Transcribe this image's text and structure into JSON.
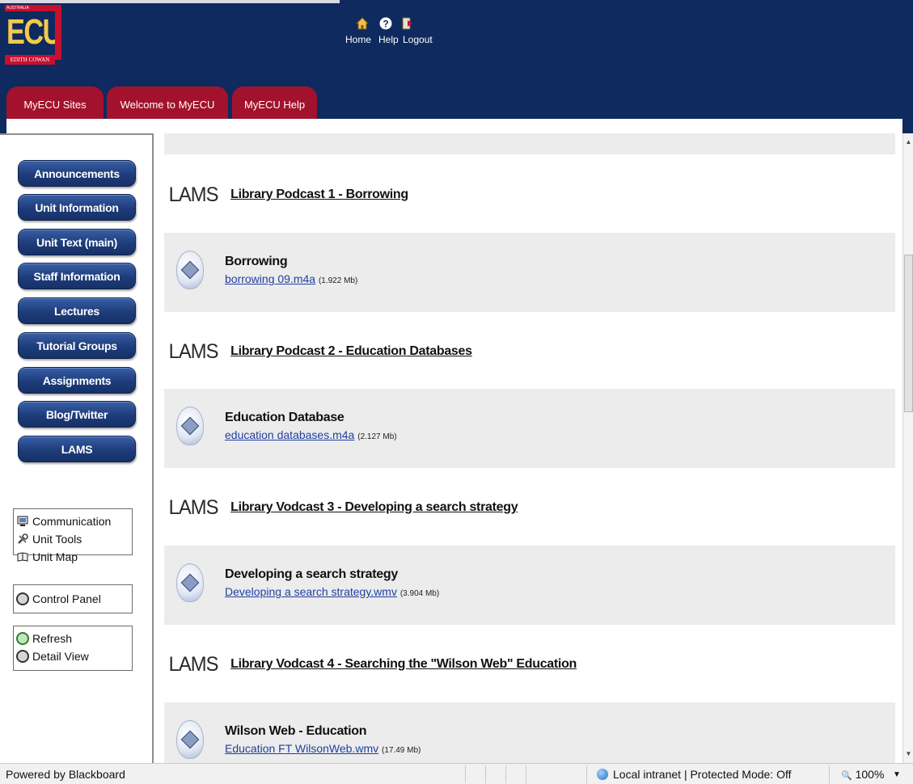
{
  "header": {
    "logo": {
      "top_text": "AUSTRALIA",
      "main_text": "ECU",
      "side_text": "UNIVERSITY",
      "bottom_text": "EDITH COWAN"
    },
    "nav": {
      "home_label": "Home",
      "help_label": "Help",
      "logout_label": "Logout",
      "icons": [
        "home-icon",
        "help-icon",
        "logout-icon"
      ]
    },
    "tabs": [
      {
        "label": "MyECU Sites"
      },
      {
        "label": "Welcome to MyECU"
      },
      {
        "label": "MyECU Help"
      }
    ]
  },
  "sidebar": {
    "buttons": [
      {
        "label": "Announcements"
      },
      {
        "label": "Unit Information"
      },
      {
        "label": "Unit Text (main)"
      },
      {
        "label": "Staff Information"
      },
      {
        "label": "Lectures"
      },
      {
        "label": "Tutorial Groups"
      },
      {
        "label": "Assignments"
      },
      {
        "label": "Blog/Twitter"
      },
      {
        "label": "LAMS"
      }
    ],
    "tools": {
      "communication": "Communication",
      "unit_tools": "Unit Tools",
      "unit_map": "Unit Map",
      "control_panel": "Control Panel",
      "refresh": "Refresh",
      "detail_view": "Detail View"
    }
  },
  "content": {
    "lams_logo_text": "LAMS",
    "entries": [
      {
        "lams_title": "Library Podcast 1 - Borrowing",
        "item_title": "Borrowing",
        "file_name": "borrowing 09.m4a",
        "file_size": "(1.922 Mb)"
      },
      {
        "lams_title": "Library Podcast 2 - Education Databases",
        "item_title": "Education Database",
        "file_name": "education databases.m4a",
        "file_size": "(2.127 Mb)"
      },
      {
        "lams_title": "Library Vodcast 3 - Developing a search strategy",
        "item_title": "Developing a search strategy",
        "file_name": "Developing a search strategy.wmv",
        "file_size": "(3.904 Mb)"
      },
      {
        "lams_title": "Library Vodcast 4 - Searching the \"Wilson Web\" Education",
        "item_title": "Wilson Web - Education",
        "file_name": "Education FT WilsonWeb.wmv",
        "file_size": "(17.49 Mb)"
      }
    ]
  },
  "statusbar": {
    "left_text": "Powered by Blackboard",
    "zone_text": "Local intranet | Protected Mode: Off",
    "zoom_text": "100%",
    "zoom_menu_icon": "chevron-down-icon"
  },
  "colors": {
    "header_bg": "#0e2a5e",
    "tab_bg": "#a3122d",
    "nav_button_bg": "#1d3c7a",
    "link_color": "#1f3fa0"
  }
}
